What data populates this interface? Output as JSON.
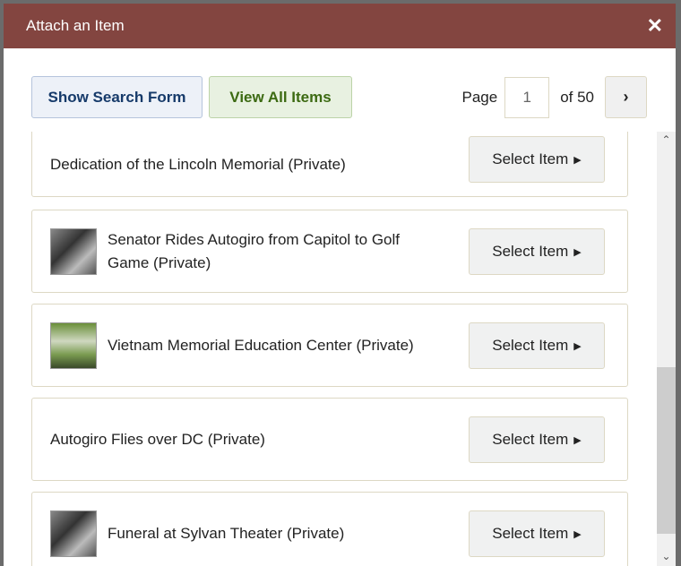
{
  "dialog": {
    "title": "Attach an Item",
    "close": "✕"
  },
  "toolbar": {
    "show_search": "Show Search Form",
    "view_all": "View All Items",
    "page_label": "Page",
    "page_value": "1",
    "of_label": "of 50",
    "next": "›"
  },
  "items": [
    {
      "title": "Dedication of the Lincoln Memorial (Private)",
      "has_thumb": false,
      "button": "Select Item",
      "arrow": "▶"
    },
    {
      "title": "Senator Rides Autogiro from Capitol to Golf Game (Private)",
      "has_thumb": true,
      "button": "Select Item",
      "arrow": "▶"
    },
    {
      "title": "Vietnam Memorial Education Center (Private)",
      "has_thumb": true,
      "button": "Select Item",
      "arrow": "▶"
    },
    {
      "title": "Autogiro Flies over DC (Private)",
      "has_thumb": false,
      "button": "Select Item",
      "arrow": "▶"
    },
    {
      "title": "Funeral at Sylvan Theater (Private)",
      "has_thumb": true,
      "button": "Select Item",
      "arrow": "▶"
    }
  ],
  "scrollbar": {
    "up": "⌃",
    "down": "⌄"
  }
}
